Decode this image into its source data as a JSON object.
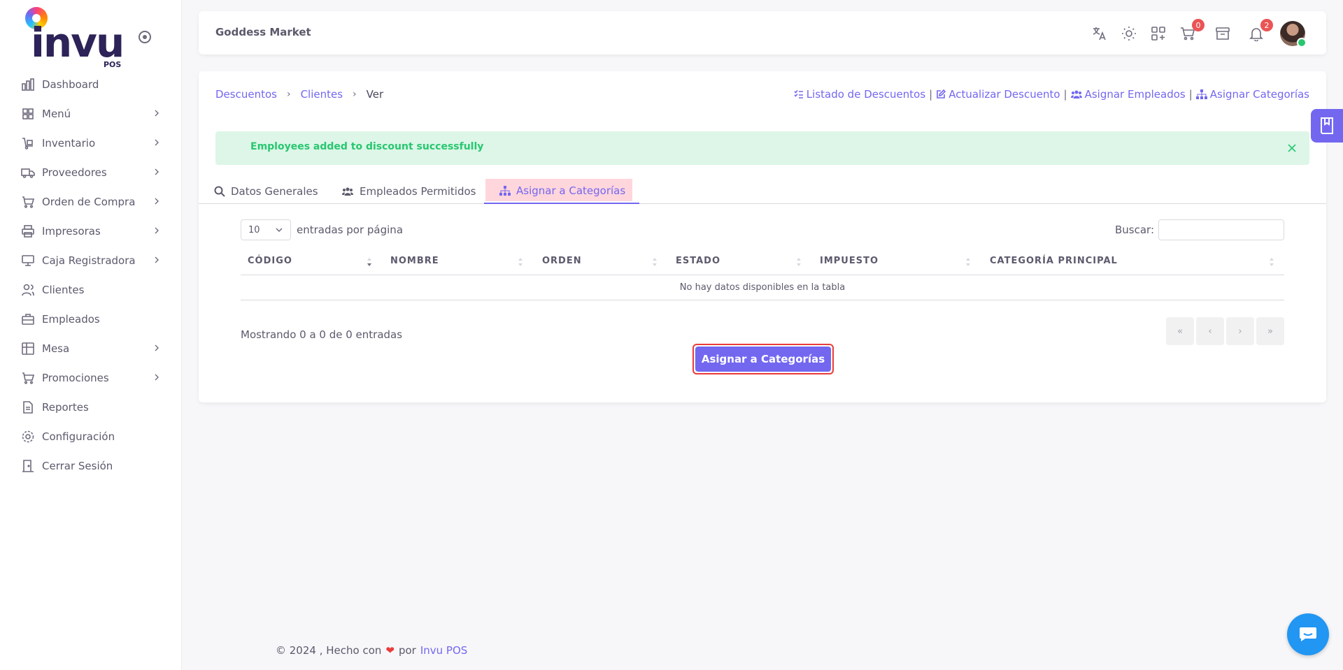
{
  "brand": {
    "logo_text": "invu",
    "logo_sub": "POS"
  },
  "sidebar": {
    "items": [
      {
        "label": "Dashboard",
        "icon": "chart-bar-icon",
        "has_children": false
      },
      {
        "label": "Menú",
        "icon": "grid-icon",
        "has_children": true
      },
      {
        "label": "Inventario",
        "icon": "dolly-icon",
        "has_children": true
      },
      {
        "label": "Proveedores",
        "icon": "truck-icon",
        "has_children": true
      },
      {
        "label": "Orden de Compra",
        "icon": "cart-icon",
        "has_children": true
      },
      {
        "label": "Impresoras",
        "icon": "printer-icon",
        "has_children": true
      },
      {
        "label": "Caja Registradora",
        "icon": "cash-register-icon",
        "has_children": true
      },
      {
        "label": "Clientes",
        "icon": "users-icon",
        "has_children": false
      },
      {
        "label": "Empleados",
        "icon": "briefcase-icon",
        "has_children": false
      },
      {
        "label": "Mesa",
        "icon": "table-icon",
        "has_children": true
      },
      {
        "label": "Promociones",
        "icon": "cart-promo-icon",
        "has_children": true
      },
      {
        "label": "Reportes",
        "icon": "file-icon",
        "has_children": false
      },
      {
        "label": "Configuración",
        "icon": "gear-icon",
        "has_children": false
      },
      {
        "label": "Cerrar Sesión",
        "icon": "door-icon",
        "has_children": false
      }
    ]
  },
  "topbar": {
    "store_name": "Goddess Market",
    "cart_count": "0",
    "notification_count": "2"
  },
  "breadcrumb": {
    "items": [
      "Descuentos",
      "Clientes"
    ],
    "current": "Ver"
  },
  "actions": {
    "list": "Listado de Descuentos",
    "update": "Actualizar Descuento",
    "assign_employees": "Asignar Empleados",
    "assign_categories": "Asignar Categorías"
  },
  "alert": {
    "message": "Employees added to discount successfully"
  },
  "tabs": {
    "general": "Datos Generales",
    "employees": "Empleados Permitidos",
    "categories": "Asignar a Categorías",
    "active": "categories"
  },
  "table_controls": {
    "page_length": "10",
    "page_length_suffix": "entradas por página",
    "search_label": "Buscar:",
    "search_value": ""
  },
  "table": {
    "columns": [
      "CÓDIGO",
      "NOMBRE",
      "ORDEN",
      "ESTADO",
      "IMPUESTO",
      "CATEGORÍA PRINCIPAL"
    ],
    "empty_message": "No hay datos disponibles en la tabla",
    "info": "Mostrando 0 a 0 de 0 entradas",
    "pager": {
      "first": "«",
      "prev": "‹",
      "next": "›",
      "last": "»"
    }
  },
  "submit_label": "Asignar a Categorías",
  "footer": {
    "text": "© 2024 , Hecho con",
    "by": "por",
    "link": "Invu POS"
  },
  "colors": {
    "accent": "#7367f0",
    "success": "#28c76f",
    "danger": "#ea5455"
  }
}
